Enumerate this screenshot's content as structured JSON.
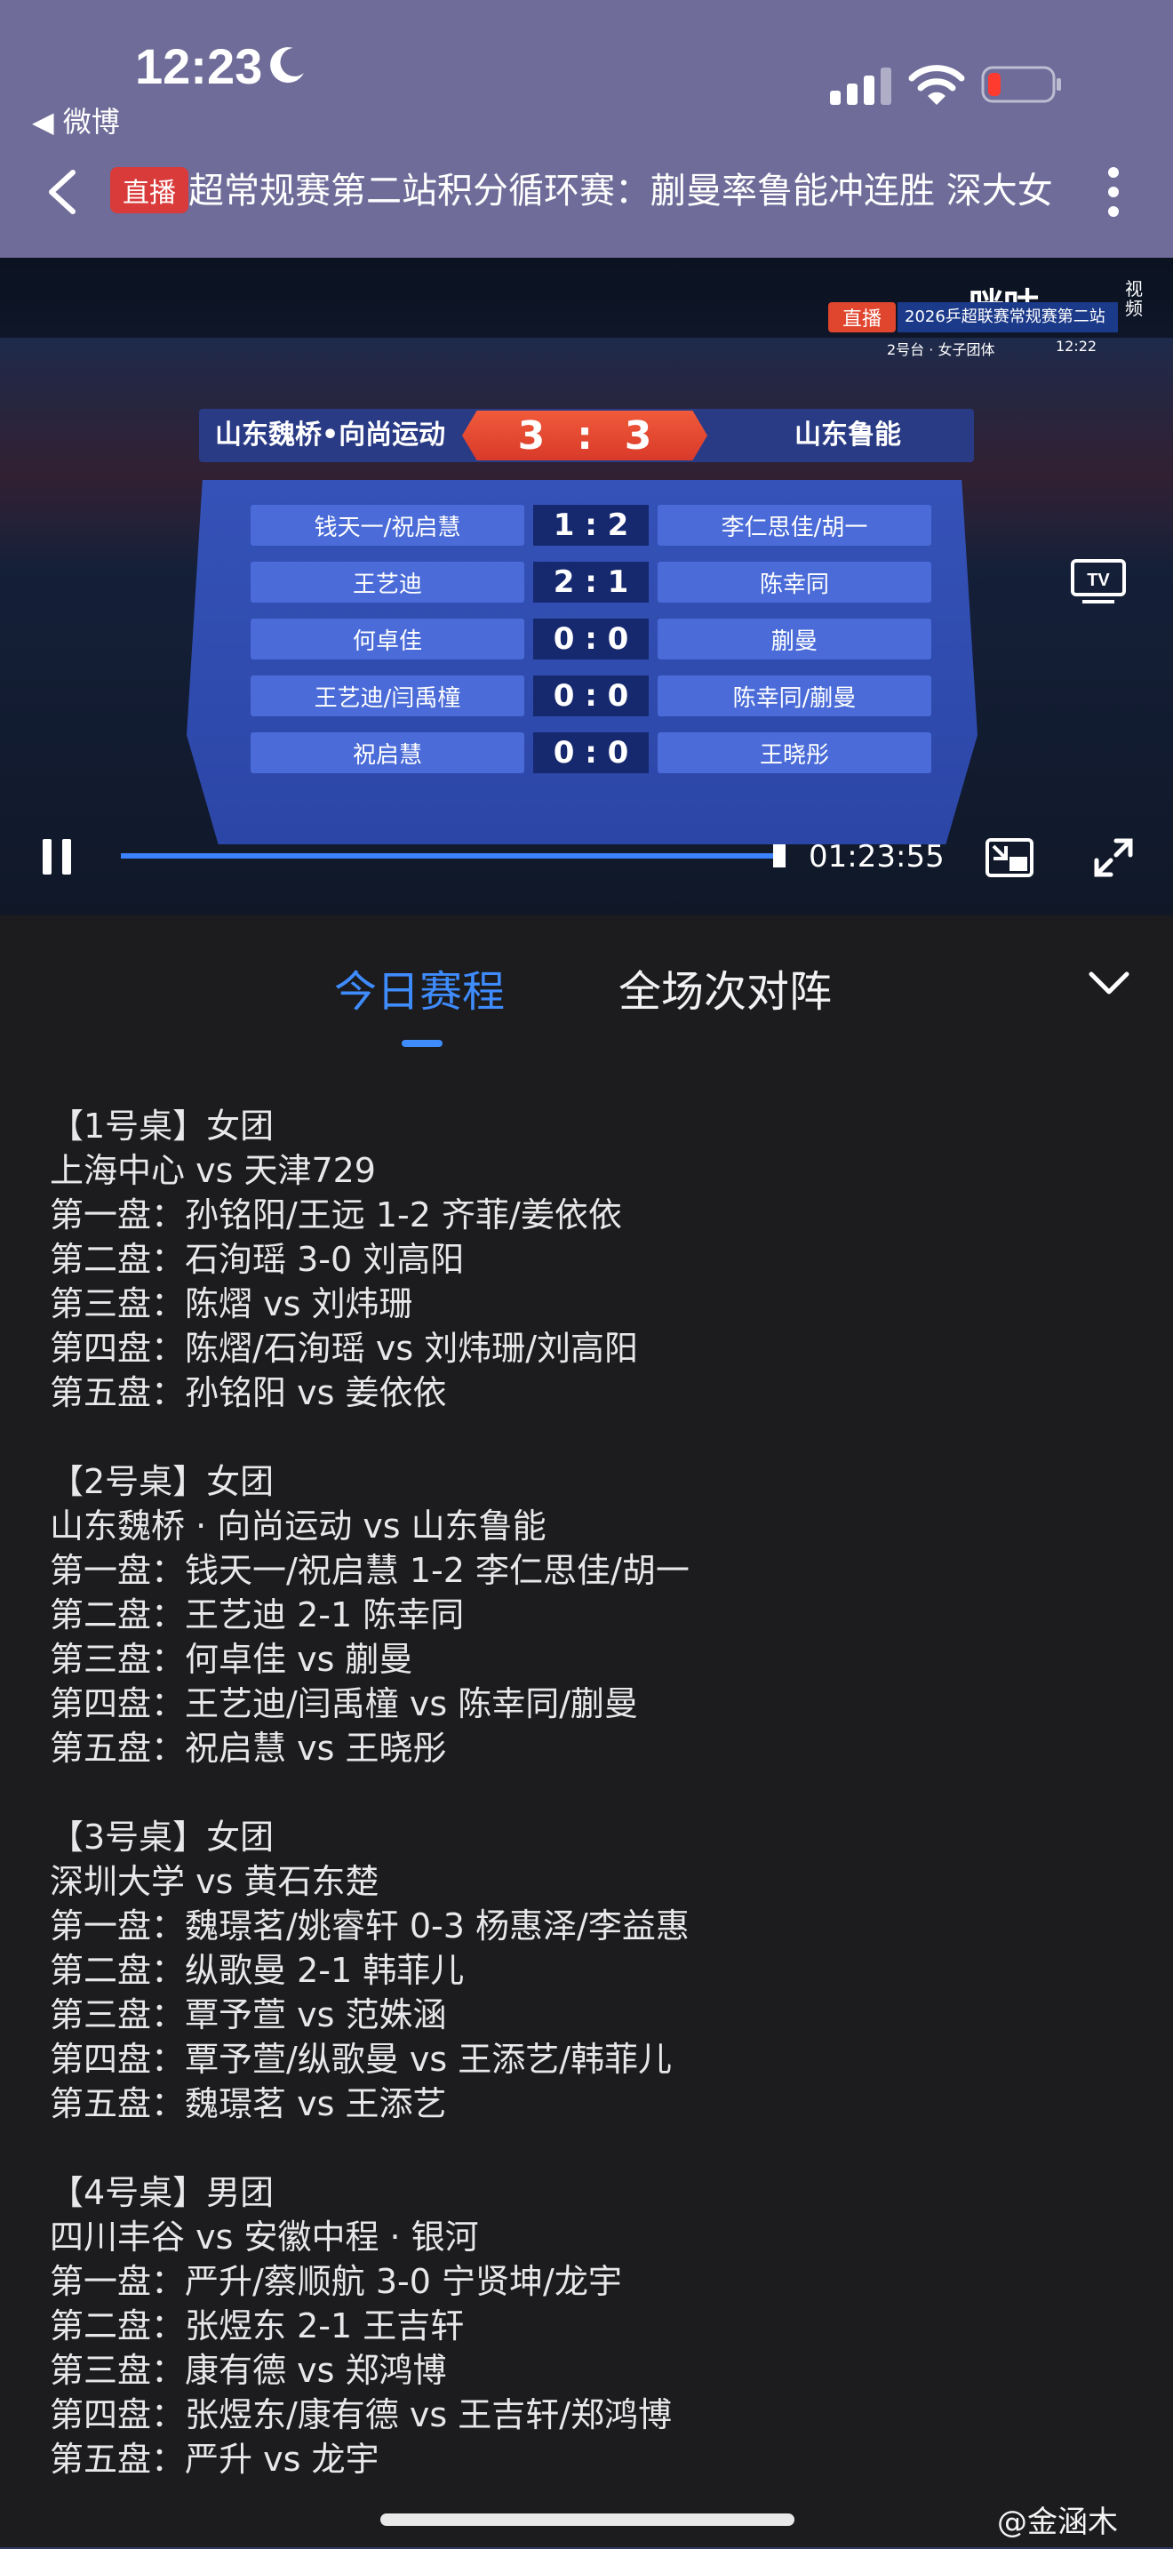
{
  "status_bar": {
    "time": "12:23",
    "back_app": "◀ 微博"
  },
  "header": {
    "live_badge": "直播",
    "title": "超常规赛第二站积分循环赛：蒯曼率鲁能冲连胜 深大女"
  },
  "video": {
    "broadcast": {
      "live": "直播",
      "title": "2026乒超联赛常规赛第二站",
      "sub": "2号台 · 女子团体",
      "time": "12:22",
      "logo": "咪咕",
      "logo_sub": "视频"
    },
    "scoreboard": {
      "team_left": "山东魏桥•向尚运动",
      "score_left": "3",
      "score_sep": ":",
      "score_right": "3",
      "team_right": "山东鲁能"
    },
    "matches": [
      {
        "left": "钱天一/祝启慧",
        "score": "1 : 2",
        "right": "李仁思佳/胡一"
      },
      {
        "left": "王艺迪",
        "score": "2 : 1",
        "right": "陈幸同"
      },
      {
        "left": "何卓佳",
        "score": "0 : 0",
        "right": "蒯曼"
      },
      {
        "left": "王艺迪/闫禹橦",
        "score": "0 : 0",
        "right": "陈幸同/蒯曼"
      },
      {
        "left": "祝启慧",
        "score": "0 : 0",
        "right": "王晓彤"
      }
    ],
    "controls": {
      "elapsed": "01:23:55",
      "progress": 0.99
    }
  },
  "tabs": {
    "active": "今日赛程",
    "inactive": "全场次对阵"
  },
  "schedule": [
    {
      "lines": [
        "【1号桌】女团",
        "上海中心 vs 天津729",
        "第一盘：孙铭阳/王远 1-2 齐菲/姜依依",
        "第二盘：石洵瑶 3-0 刘高阳",
        "第三盘：陈熠 vs 刘炜珊",
        "第四盘：陈熠/石洵瑶 vs 刘炜珊/刘高阳",
        "第五盘：孙铭阳 vs 姜依依"
      ]
    },
    {
      "lines": [
        "【2号桌】女团",
        "山东魏桥 · 向尚运动 vs 山东鲁能",
        "第一盘：钱天一/祝启慧 1-2 李仁思佳/胡一",
        "第二盘：王艺迪 2-1 陈幸同",
        "第三盘：何卓佳 vs 蒯曼",
        "第四盘：王艺迪/闫禹橦 vs 陈幸同/蒯曼",
        "第五盘：祝启慧 vs 王晓彤"
      ]
    },
    {
      "lines": [
        "【3号桌】女团",
        "深圳大学 vs 黄石东楚",
        "第一盘：魏璟茗/姚睿轩 0-3 杨惠泽/李益惠",
        "第二盘：纵歌曼 2-1 韩菲儿",
        "第三盘：覃予萱 vs 范姝涵",
        "第四盘：覃予萱/纵歌曼 vs 王添艺/韩菲儿",
        "第五盘：魏璟茗 vs 王添艺"
      ]
    },
    {
      "lines": [
        "【4号桌】男团",
        "四川丰谷 vs 安徽中程 · 银河",
        "第一盘：严升/蔡顺航 3-0 宁贤坤/龙宇",
        "第二盘：张煜东 2-1 王吉轩",
        "第三盘：康有德 vs 郑鸿博",
        "第四盘：张煜东/康有德 vs 王吉轩/郑鸿博",
        "第五盘：严升 vs 龙宇"
      ]
    }
  ],
  "watermark": "@金涵木",
  "colors": {
    "header_bg": "#6f6c99",
    "accent": "#3f8cff",
    "live_red": "#d93a3a",
    "panel_bg": "#1c1c1e"
  },
  "icons": [
    "moon-icon",
    "signal-icon",
    "wifi-icon",
    "battery-icon",
    "back-chevron-icon",
    "more-vertical-icon",
    "tv-icon",
    "pause-icon",
    "pip-icon",
    "fullscreen-icon",
    "chevron-down-icon",
    "weibo-icon"
  ]
}
